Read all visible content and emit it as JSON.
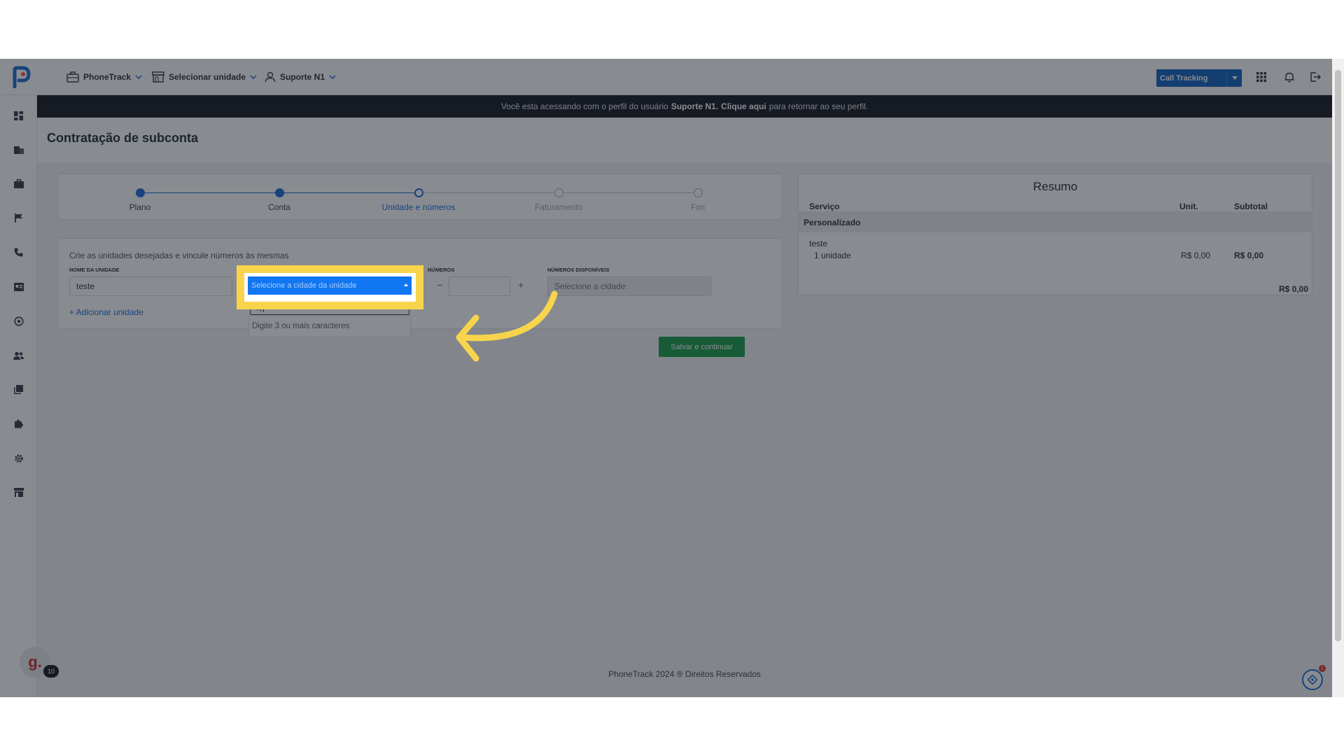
{
  "nav": {
    "app_menu": "PhoneTrack",
    "unit_menu": "Selecionar unidade",
    "user_menu": "Suporte N1",
    "product_button": "Call Tracking"
  },
  "banner": {
    "prefix": "Você esta acessando com o perfil do usuário",
    "user": "Suporte N1.",
    "link": "Clique aqui",
    "suffix": "para retornar ao seu perfil."
  },
  "page": {
    "title": "Contratação de subconta"
  },
  "stepper": {
    "steps": [
      {
        "label": "Plano",
        "state": "done"
      },
      {
        "label": "Conta",
        "state": "done"
      },
      {
        "label": "Unidade e números",
        "state": "active"
      },
      {
        "label": "Faturamento",
        "state": "todo"
      },
      {
        "label": "Fim",
        "state": "todo"
      }
    ]
  },
  "units_form": {
    "description": "Crie as unidades desejadas e vincule números às mesmas",
    "unit_name_label": "NOME DA UNIDADE",
    "unit_name_value": "teste",
    "numbers_label": "NÚMEROS",
    "available_label": "NÚMEROS DISPONÍVEIS",
    "available_placeholder": "Selecione a cidade",
    "minus": "−",
    "plus": "+",
    "add_unit": "+ Adicionar unidade"
  },
  "city_select": {
    "placeholder": "Selecione a cidade da unidade",
    "hint": "Digite 3 ou mais caracteres"
  },
  "actions": {
    "save": "Salvar e continuar"
  },
  "summary": {
    "title": "Resumo",
    "col_service": "Serviço",
    "col_unit": "Unit.",
    "col_subtotal": "Subtotal",
    "group": "Personalizado",
    "item_name": "teste",
    "item_qty": "1 unidade",
    "item_unit_price": "R$ 0,00",
    "item_subtotal": "R$ 0,00",
    "total": "R$ 0,00"
  },
  "footer": {
    "text": "PhoneTrack 2024 ® Direitos Reservados"
  },
  "widgets": {
    "g_letter": "g.",
    "g_count": "10",
    "help_count": "1"
  },
  "colors": {
    "primary": "#1e6fd9",
    "success": "#1e9e4d",
    "highlight": "#f7d44c",
    "banner": "#1a1d24"
  }
}
